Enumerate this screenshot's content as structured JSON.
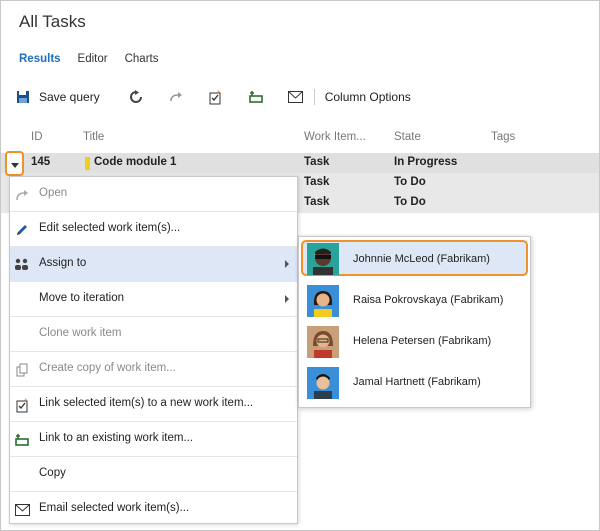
{
  "page": {
    "title": "All Tasks"
  },
  "tabs": [
    {
      "label": "Results",
      "active": true
    },
    {
      "label": "Editor",
      "active": false
    },
    {
      "label": "Charts",
      "active": false
    }
  ],
  "toolbar": {
    "save_query": "Save query",
    "column_options": "Column Options",
    "icons": [
      "save-icon",
      "refresh-icon",
      "redo-icon",
      "new-linked-icon",
      "link-existing-icon",
      "email-icon"
    ]
  },
  "grid": {
    "columns": {
      "id": "ID",
      "title": "Title",
      "work_item": "Work Item...",
      "state": "State",
      "tags": "Tags"
    },
    "rows": [
      {
        "id": "145",
        "title": "Code module 1",
        "type": "Task",
        "state": "In Progress"
      },
      {
        "id": "",
        "title": "",
        "type": "Task",
        "state": "To Do"
      },
      {
        "id": "",
        "title": "",
        "type": "Task",
        "state": "To Do"
      }
    ]
  },
  "context_menu": {
    "items": [
      {
        "label": "Open",
        "disabled": true
      },
      {
        "label": "Edit selected work item(s)...",
        "disabled": false
      },
      {
        "label": "Assign to",
        "disabled": false
      },
      {
        "label": "Move to iteration",
        "disabled": false
      },
      {
        "label": "Clone work item",
        "disabled": true
      },
      {
        "label": "Create copy of work item...",
        "disabled": true
      },
      {
        "label": "Link selected item(s) to a new work item...",
        "disabled": false
      },
      {
        "label": "Link to an existing work item...",
        "disabled": false
      },
      {
        "label": "Copy",
        "disabled": false
      },
      {
        "label": "Email selected work item(s)...",
        "disabled": false
      }
    ]
  },
  "assign_submenu": {
    "people": [
      {
        "name": "Johnnie McLeod  (Fabrikam)"
      },
      {
        "name": "Raisa Pokrovskaya (Fabrikam)"
      },
      {
        "name": "Helena Petersen (Fabrikam)"
      },
      {
        "name": "Jamal Hartnett (Fabrikam)"
      }
    ]
  },
  "colors": {
    "accent": "#1d6fbf",
    "highlight": "#f0922b",
    "selected_bg": "#dde7f5",
    "task_bar": "#f2cb1d"
  }
}
